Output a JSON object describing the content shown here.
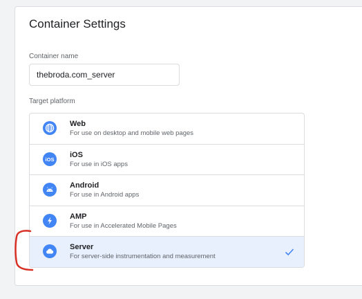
{
  "card": {
    "title": "Container Settings",
    "name_label": "Container name",
    "name_value": "thebroda.com_server",
    "platform_label": "Target platform"
  },
  "platforms": [
    {
      "name": "Web",
      "description": "For use on desktop and mobile web pages",
      "icon": "globe-icon"
    },
    {
      "name": "iOS",
      "description": "For use in iOS apps",
      "icon": "ios-icon"
    },
    {
      "name": "Android",
      "description": "For use in Android apps",
      "icon": "android-icon"
    },
    {
      "name": "AMP",
      "description": "For use in Accelerated Mobile Pages",
      "icon": "lightning-icon"
    },
    {
      "name": "Server",
      "description": "For server-side instrumentation and measurement",
      "icon": "cloud-icon",
      "selected": true
    }
  ],
  "colors": {
    "accent": "#4285f4",
    "selected_bg": "#e8f0fe",
    "annotation": "#d93025"
  }
}
